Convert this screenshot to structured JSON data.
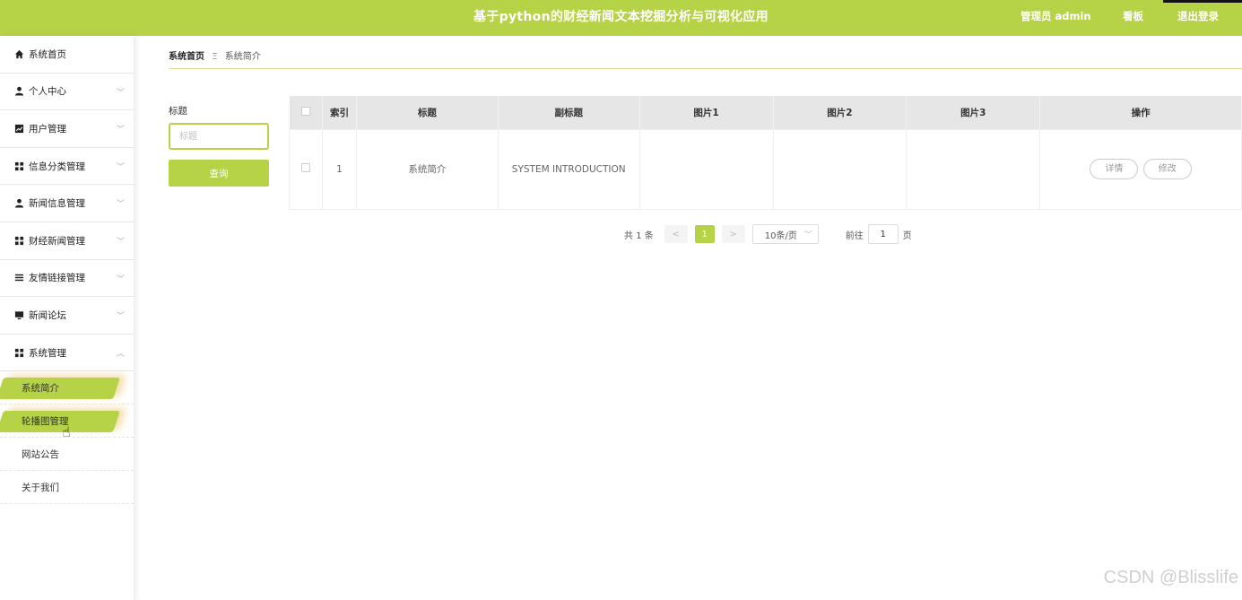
{
  "header": {
    "title": "基于python的财经新闻文本挖掘分析与可视化应用",
    "user_label": "管理员 admin",
    "dashboard_label": "看板",
    "logout_label": "退出登录"
  },
  "sidebar": {
    "items": [
      {
        "label": "系统首页",
        "icon": "home-icon"
      },
      {
        "label": "个人中心",
        "icon": "user-icon"
      },
      {
        "label": "用户管理",
        "icon": "chart-icon"
      },
      {
        "label": "信息分类管理",
        "icon": "grid-icon"
      },
      {
        "label": "新闻信息管理",
        "icon": "user-icon"
      },
      {
        "label": "财经新闻管理",
        "icon": "grid-icon"
      },
      {
        "label": "友情链接管理",
        "icon": "list-icon"
      },
      {
        "label": "新闻论坛",
        "icon": "monitor-icon"
      },
      {
        "label": "系统管理",
        "icon": "grid-icon"
      }
    ],
    "sub_items": [
      {
        "label": "系统简介"
      },
      {
        "label": "轮播图管理"
      },
      {
        "label": "网站公告"
      },
      {
        "label": "关于我们"
      }
    ]
  },
  "breadcrumb": {
    "home": "系统首页",
    "separator": "Ξ",
    "current": "系统简介"
  },
  "search": {
    "label": "标题",
    "placeholder": "标题",
    "button_label": "查询"
  },
  "table": {
    "headers": [
      "索引",
      "标题",
      "副标题",
      "图片1",
      "图片2",
      "图片3",
      "操作"
    ],
    "rows": [
      {
        "index": "1",
        "title": "系统简介",
        "subtitle": "SYSTEM INTRODUCTION",
        "img1": "",
        "img2": "",
        "img3": "",
        "detail_label": "详情",
        "edit_label": "修改"
      }
    ]
  },
  "pagination": {
    "total_text": "共 1 条",
    "prev": "<",
    "current_page": "1",
    "next": ">",
    "page_size": "10条/页",
    "goto_label": "前往",
    "goto_value": "1",
    "page_suffix": "页"
  },
  "watermark": "CSDN @Blisslife",
  "colors": {
    "accent": "#b6d347"
  }
}
